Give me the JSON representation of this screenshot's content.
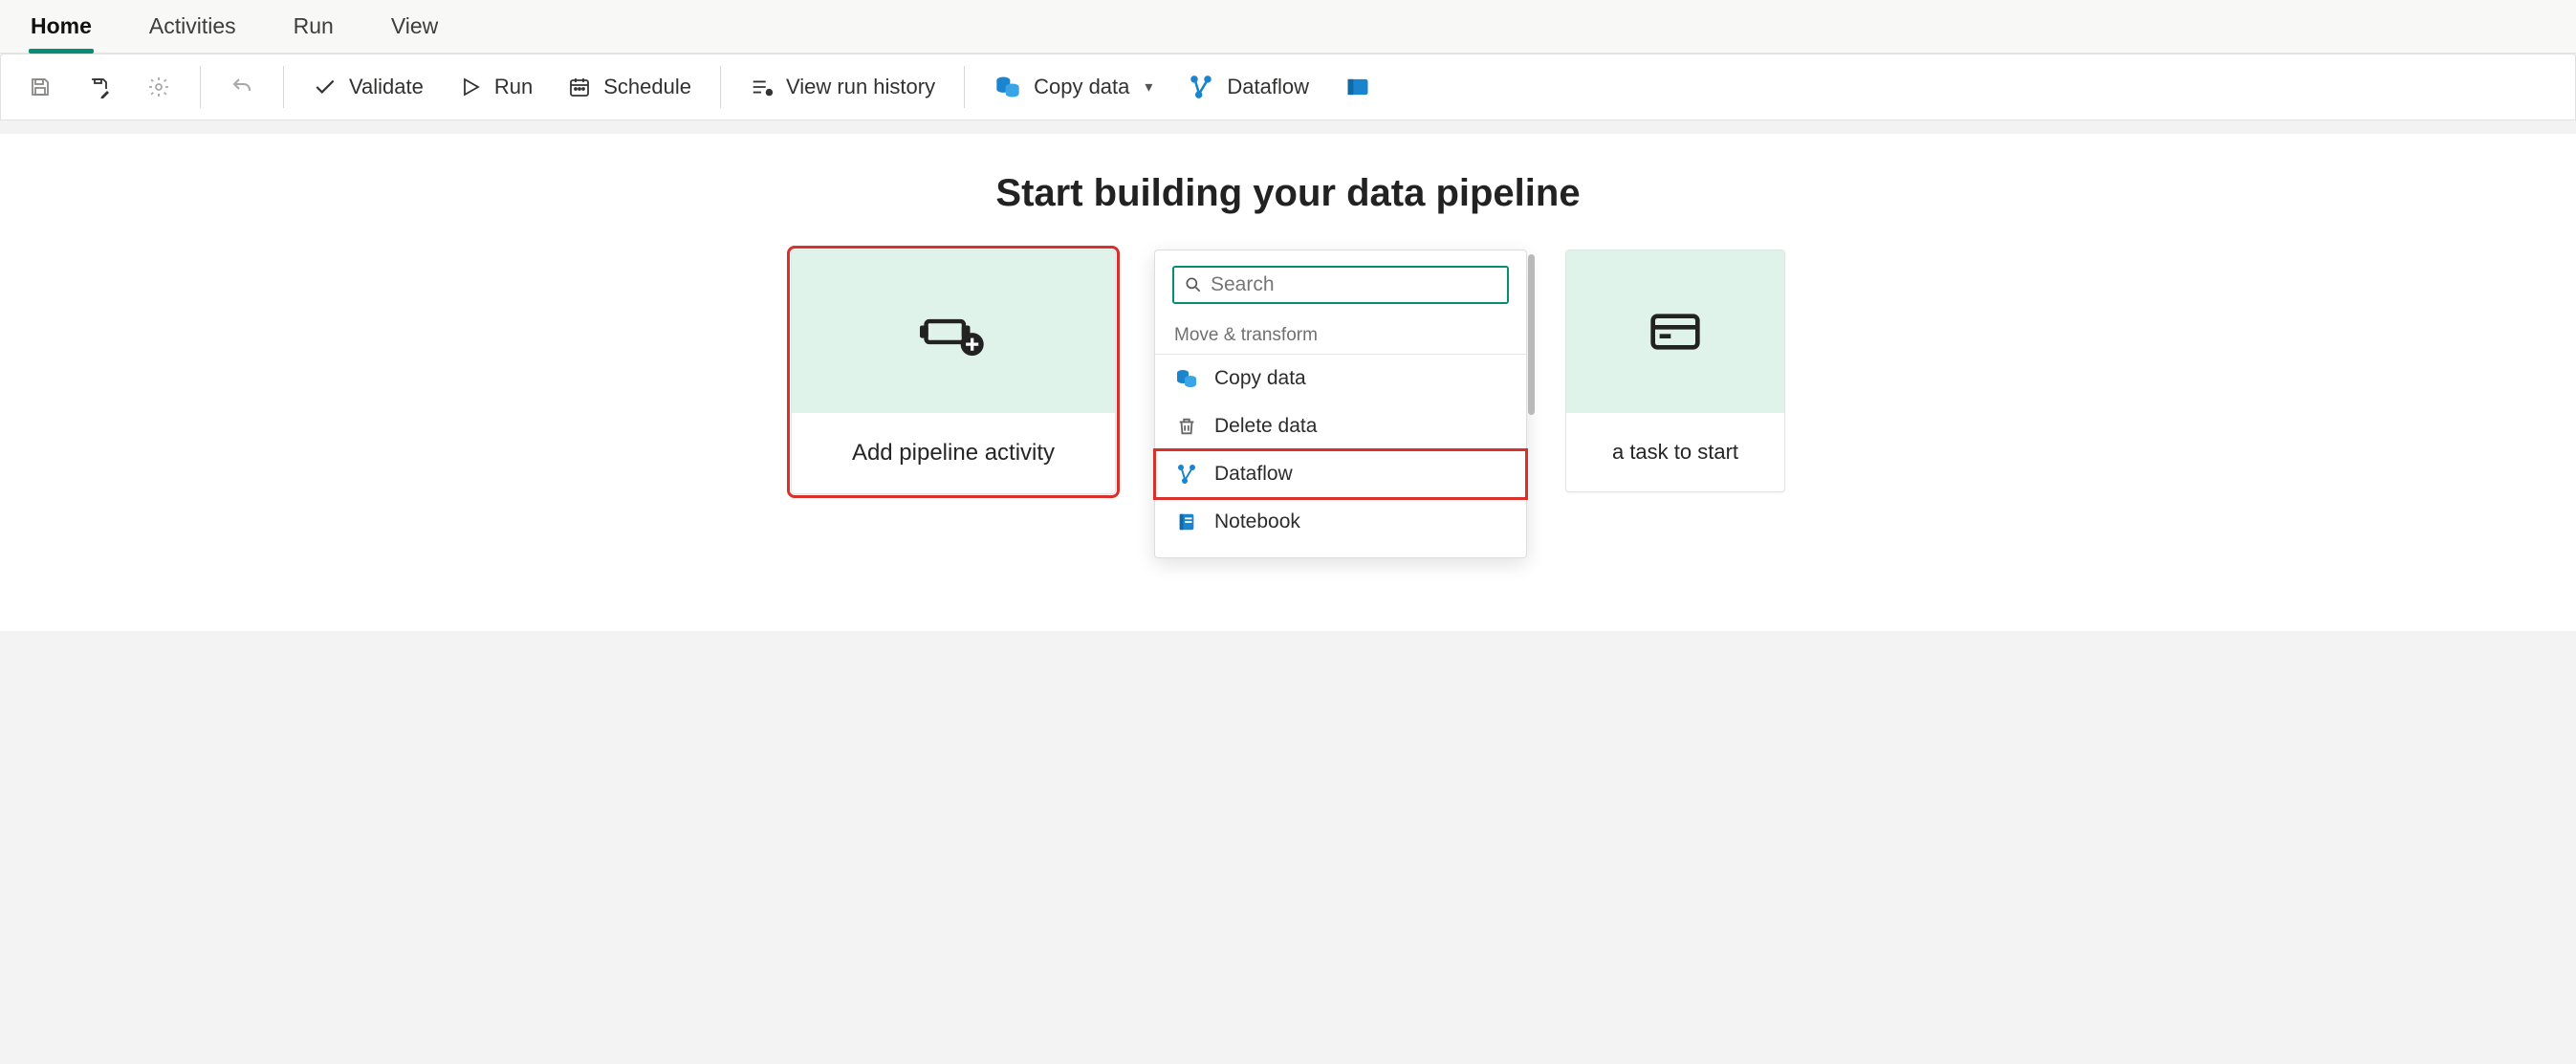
{
  "tabs": {
    "items": [
      {
        "label": "Home",
        "active": true
      },
      {
        "label": "Activities",
        "active": false
      },
      {
        "label": "Run",
        "active": false
      },
      {
        "label": "View",
        "active": false
      }
    ]
  },
  "toolbar": {
    "validate": "Validate",
    "run": "Run",
    "schedule": "Schedule",
    "viewRunHistory": "View run history",
    "copyData": "Copy data",
    "dataflow": "Dataflow"
  },
  "main": {
    "heading": "Start building your data pipeline"
  },
  "card": {
    "addActivity": "Add pipeline activity",
    "taskToStart": "a task to start"
  },
  "popup": {
    "searchPlaceholder": "Search",
    "groupLabel": "Move & transform",
    "items": [
      {
        "label": "Copy data",
        "icon": "copy-data-icon",
        "highlight": false
      },
      {
        "label": "Delete data",
        "icon": "trash-icon",
        "highlight": false
      },
      {
        "label": "Dataflow",
        "icon": "dataflow-icon",
        "highlight": true
      },
      {
        "label": "Notebook",
        "icon": "notebook-icon",
        "highlight": false
      }
    ]
  },
  "colors": {
    "accent": "#078d74",
    "blue": "#1a84cf",
    "highlight": "#d9302a"
  }
}
